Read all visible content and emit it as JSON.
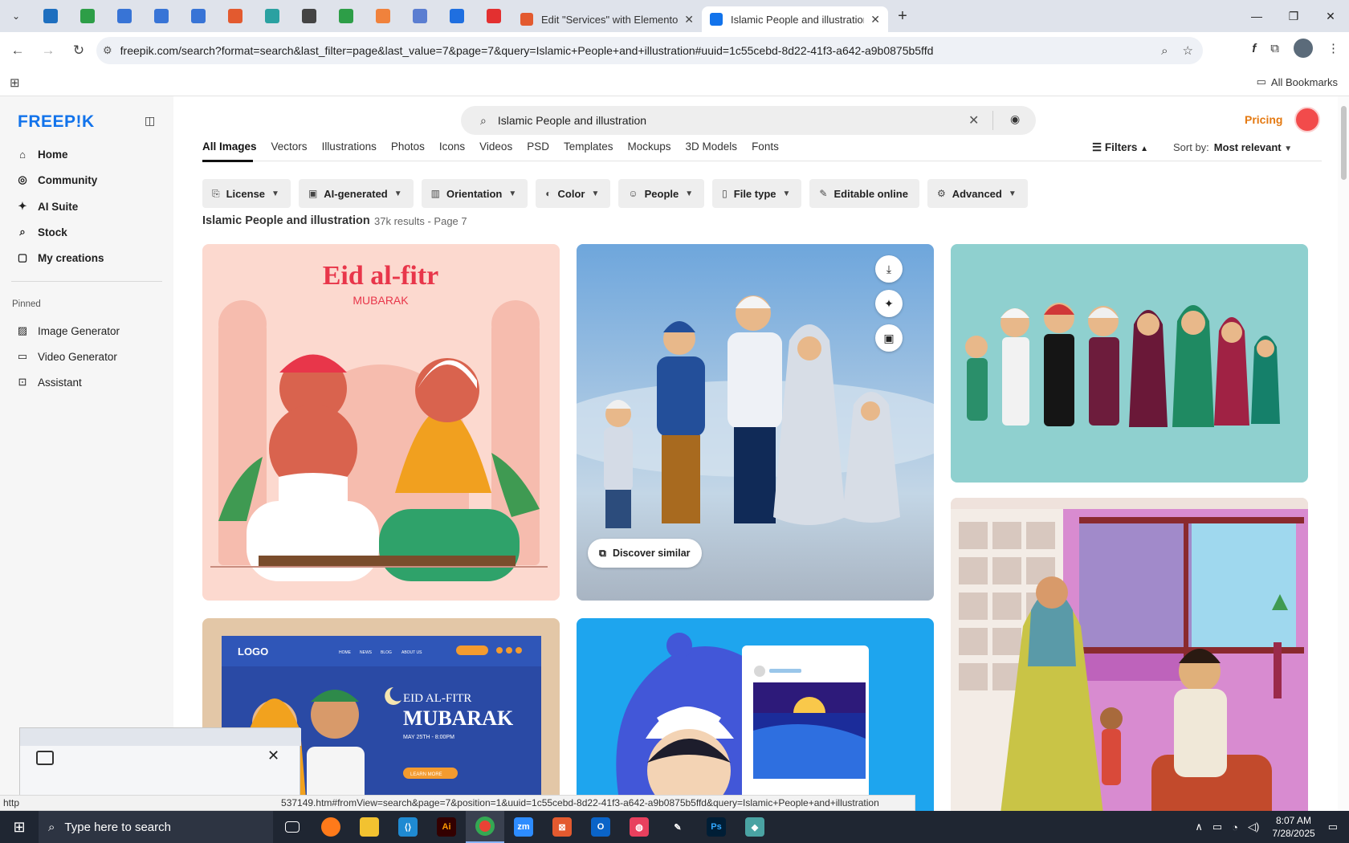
{
  "browser": {
    "tabs": [
      {
        "title": "Edit \"Services\" with Elementor",
        "favicon_color": "#e35a2f",
        "active": false
      },
      {
        "title": "Islamic People and illustration v",
        "favicon_color": "#1273eb",
        "active": true
      }
    ],
    "pinned_favicon_colors": [
      "#1e6fbf",
      "#2d9e47",
      "#3874d6",
      "#3874d6",
      "#3874d6",
      "#e35a2f",
      "#2aa1a1",
      "#444444",
      "#2d9e47",
      "#f0823c",
      "#5b7ed1",
      "#1f6fe0",
      "#e33030"
    ],
    "url": "freepik.com/search?format=search&last_filter=page&last_value=7&page=7&query=Islamic+People+and+illustration#uuid=1c55cebd-8d22-41f3-a642-a9b0875b5ffd",
    "bookmarks_all": "All Bookmarks",
    "status_url": "https://www.freepik.com/free-vector/islamic-people-illustration_537149.htm#fromView=search&page=7&position=1&uuid=1c55cebd-8d22-41f3-a642-a9b0875b5ffd&query=Islamic+People+and+illustration",
    "status_visible": "http",
    "status_rest": "537149.htm#fromView=search&page=7&position=1&uuid=1c55cebd-8d22-41f3-a642-a9b0875b5ffd&query=Islamic+People+and+illustration"
  },
  "sidebar": {
    "logo": "FREEP!K",
    "nav": [
      {
        "label": "Home",
        "icon": "home-icon"
      },
      {
        "label": "Community",
        "icon": "globe-icon"
      },
      {
        "label": "AI Suite",
        "icon": "sparkle-icon"
      },
      {
        "label": "Stock",
        "icon": "search-icon"
      },
      {
        "label": "My creations",
        "icon": "folder-icon"
      }
    ],
    "pinned_label": "Pinned",
    "pinned": [
      {
        "label": "Image Generator",
        "icon": "image-icon"
      },
      {
        "label": "Video Generator",
        "icon": "video-icon"
      },
      {
        "label": "Assistant",
        "icon": "chat-icon"
      }
    ]
  },
  "search": {
    "value": "Islamic People and illustration",
    "pricing": "Pricing"
  },
  "type_tabs": [
    "All Images",
    "Vectors",
    "Illustrations",
    "Photos",
    "Icons",
    "Videos",
    "PSD",
    "Templates",
    "Mockups",
    "3D Models",
    "Fonts"
  ],
  "filters_label": "Filters",
  "sort": {
    "label": "Sort by:",
    "value": "Most relevant"
  },
  "chips": [
    {
      "label": "License",
      "icon": "license-icon"
    },
    {
      "label": "AI-generated",
      "icon": "ai-icon"
    },
    {
      "label": "Orientation",
      "icon": "orientation-icon"
    },
    {
      "label": "Color",
      "icon": "palette-icon"
    },
    {
      "label": "People",
      "icon": "people-icon"
    },
    {
      "label": "File type",
      "icon": "file-icon"
    },
    {
      "label": "Editable online",
      "icon": "pencil-icon"
    },
    {
      "label": "Advanced",
      "icon": "gear-icon"
    }
  ],
  "results": {
    "title": "Islamic People and illustration",
    "count": "37k results - Page 7"
  },
  "cards": {
    "eid_title": "Eid al-fitr",
    "eid_sub": "MUBARAK",
    "discover": "Discover similar",
    "banner_logo": "LOGO",
    "banner_nav": [
      "HOME",
      "NEWS",
      "BLOG",
      "ABOUT US"
    ],
    "banner_title1": "EID AL-FITR",
    "banner_title2": "MUBARAK",
    "banner_date": "MAY 25TH - 8:00PM",
    "banner_cta": "LEARN MORE"
  },
  "taskbar": {
    "search_placeholder": "Type here to search",
    "time": "8:07 AM",
    "date": "7/28/2025",
    "apps": [
      "task-view",
      "firefox",
      "file-explorer",
      "vscode",
      "illustrator",
      "chrome",
      "zoom",
      "tool",
      "outlook",
      "creative-cloud",
      "pen",
      "photoshop",
      "app"
    ]
  }
}
